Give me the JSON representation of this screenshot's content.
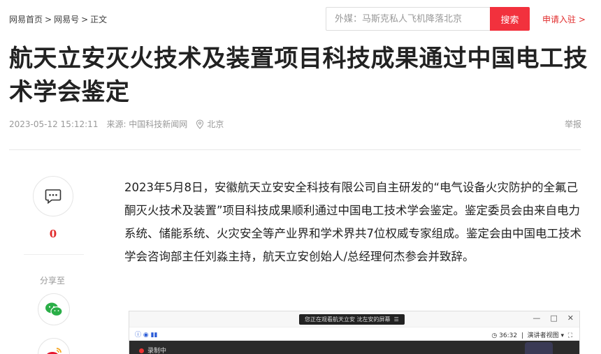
{
  "breadcrumb": {
    "home": "网易首页",
    "sep": ">",
    "section": "网易号",
    "current": "正文"
  },
  "search": {
    "placeholder": "外媒：马斯克私人飞机降落北京",
    "button": "搜索"
  },
  "apply_link": "申请入驻 >",
  "article": {
    "title": "航天立安灭火技术及装置项目科技成果通过中国电工技术学会鉴定",
    "date": "2023-05-12 15:12:11",
    "source": "来源: 中国科技新闻网",
    "location": "北京",
    "report": "举报",
    "paragraph": "2023年5月8日，安徽航天立安安全科技有限公司自主研发的“电气设备火灾防护的全氟己酮灭火技术及装置”项目科技成果顺利通过中国电工技术学会鉴定。鉴定委员会由来自电力系统、储能系统、火灾安全等产业界和学术界共7位权威专家组成。鉴定会由中国电工技术学会咨询部主任刘淼主持，航天立安创始人/总经理何杰参会并致辞。"
  },
  "sidebar": {
    "comment_count": "0",
    "share_label": "分享至"
  },
  "screenshot": {
    "banner": "您正在观看航天立安 沈左安的屏幕",
    "banner_icon": "☰",
    "window_controls": [
      "—",
      "□",
      "✕"
    ],
    "timer": "36:32",
    "view_label": "演讲者视图 ▾",
    "recording": "录制中"
  },
  "colors": {
    "accent": "#f2313d",
    "link_red": "#e12b2b"
  }
}
